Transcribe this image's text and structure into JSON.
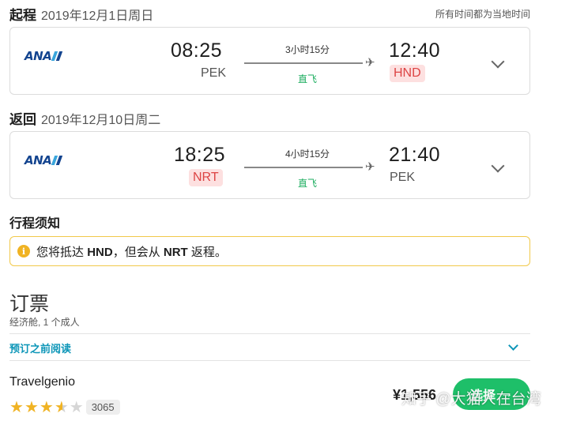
{
  "outbound": {
    "label": "起程",
    "date": "2019年12月1日周日",
    "airline": "ANA",
    "depart_time": "08:25",
    "depart_code": "PEK",
    "duration": "3小时15分",
    "stops": "直飞",
    "arrive_time": "12:40",
    "arrive_code": "HND"
  },
  "timezone_note": "所有时间都为当地时间",
  "return": {
    "label": "返回",
    "date": "2019年12月10日周二",
    "airline": "ANA",
    "depart_time": "18:25",
    "depart_code": "NRT",
    "duration": "4小时15分",
    "stops": "直飞",
    "arrive_time": "21:40",
    "arrive_code": "PEK"
  },
  "notice": {
    "title": "行程须知",
    "text_pre": "您将抵达",
    "code1": "HND",
    "text_mid": "，但会从",
    "code2": "NRT",
    "text_post": "返程。"
  },
  "booking": {
    "title": "订票",
    "subtitle": "经济舱, 1 个成人",
    "read_before": "预订之前阅读"
  },
  "offer": {
    "agency": "Travelgenio",
    "rating_stars": 3.5,
    "review_count": "3065",
    "price": "¥1,556",
    "select_label": "选择",
    "select_arrow": "→"
  },
  "watermark": "知乎 @大猫人在台湾",
  "colors": {
    "accent_green": "#1ebf69",
    "link_teal": "#0d96b8",
    "airport_highlight_bg": "#fde0e0",
    "airport_highlight_text": "#d44444",
    "notice_border": "#f1c94a",
    "star": "#f0b323",
    "ana_blue": "#13448f"
  }
}
